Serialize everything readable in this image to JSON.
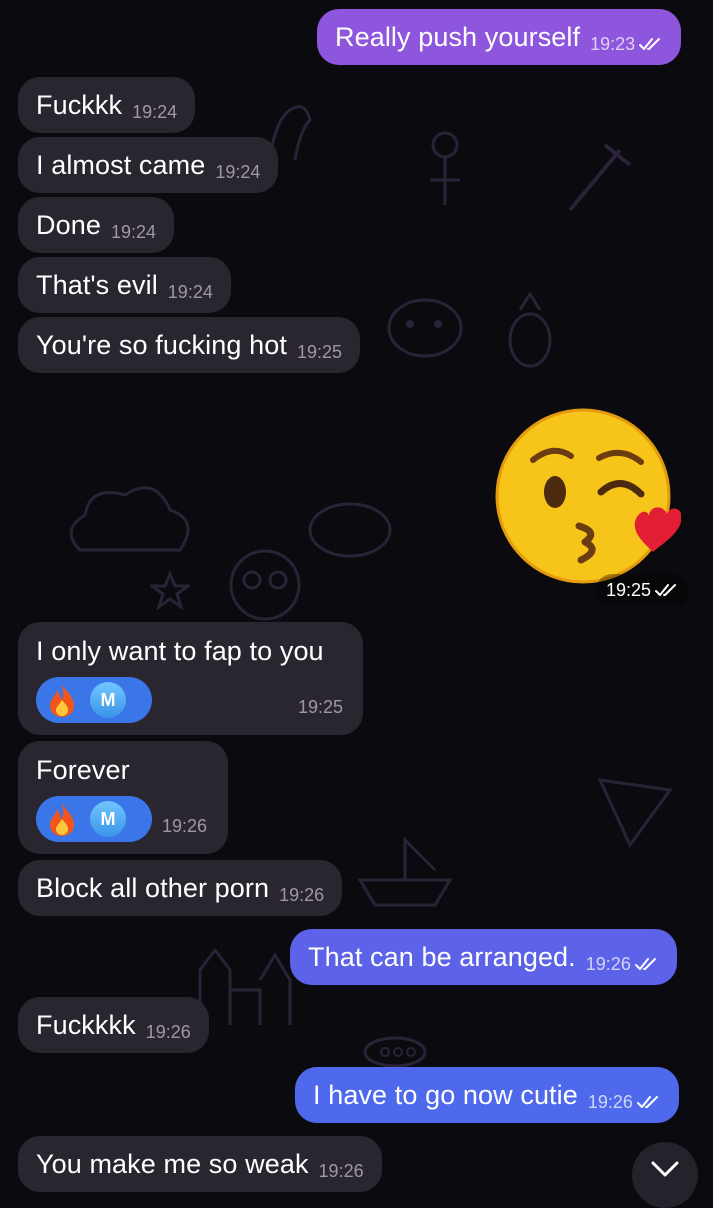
{
  "colors": {
    "incoming_bubble": "#2a2630",
    "outgoing_bubble_purple": "#8e56dc",
    "outgoing_bubble_blue": "#5c63e8",
    "reaction_pill": "#3a76e8",
    "background": "#0b0a0f"
  },
  "messages": [
    {
      "dir": "out",
      "text": "Really push yourself",
      "time": "19:23",
      "status": "read"
    },
    {
      "dir": "in",
      "text": "Fuckkk",
      "time": "19:24"
    },
    {
      "dir": "in",
      "text": "I almost came",
      "time": "19:24"
    },
    {
      "dir": "in",
      "text": "Done",
      "time": "19:24"
    },
    {
      "dir": "in",
      "text": "That's evil",
      "time": "19:24"
    },
    {
      "dir": "in",
      "text": "You're so fucking hot",
      "time": "19:25"
    },
    {
      "dir": "out",
      "sticker": "kissing-face-with-heart",
      "time": "19:25",
      "status": "read"
    },
    {
      "dir": "in",
      "text": "I only want to fap to you",
      "time": "19:25",
      "reaction": {
        "emoji": "fire",
        "avatar_initial": "M"
      }
    },
    {
      "dir": "in",
      "text": "Forever",
      "time": "19:26",
      "reaction": {
        "emoji": "fire",
        "avatar_initial": "M"
      }
    },
    {
      "dir": "in",
      "text": "Block all other porn",
      "time": "19:26"
    },
    {
      "dir": "out",
      "text": "That can be arranged.",
      "time": "19:26",
      "status": "read"
    },
    {
      "dir": "in",
      "text": "Fuckkkk",
      "time": "19:26"
    },
    {
      "dir": "out",
      "text": "I have to go now cutie",
      "time": "19:26",
      "status": "read"
    },
    {
      "dir": "in",
      "text": "You make me so weak",
      "time": "19:26"
    }
  ],
  "icons": {
    "read_status": "double-check-icon",
    "reaction": "fire-emoji-icon",
    "scroll": "chevron-down-icon"
  }
}
